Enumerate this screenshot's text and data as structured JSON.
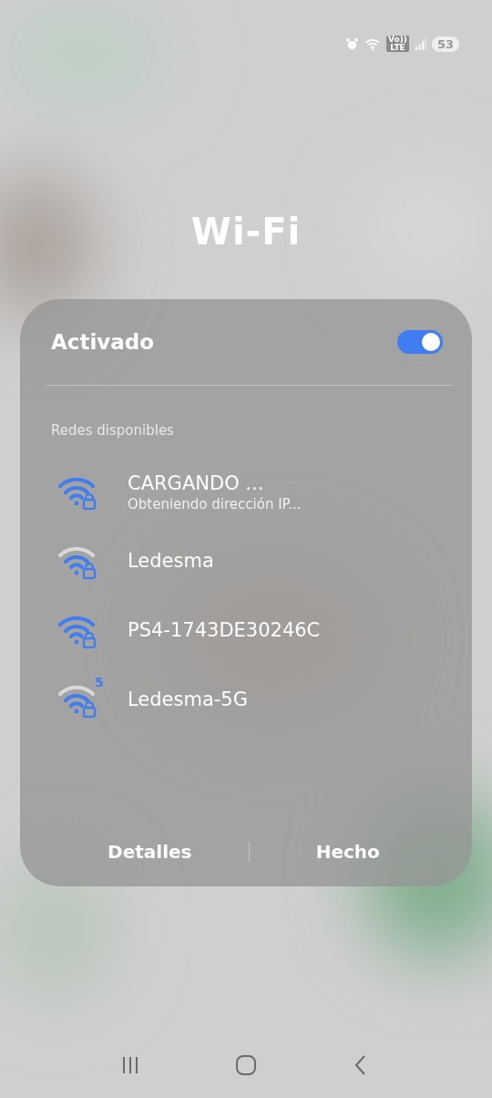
{
  "status_bar": {
    "network_label": "Vo))\nLTE",
    "battery": "53"
  },
  "title": "Wi-Fi",
  "wifi_switch": {
    "label": "Activado",
    "on": true
  },
  "section_label": "Redes disponibles",
  "networks": [
    {
      "name": "CARGANDO ...",
      "status": "Obteniendo dirección IP...",
      "full_signal": true
    },
    {
      "name": "Ledesma",
      "full_signal": false
    },
    {
      "name": "PS4-1743DE30246C",
      "full_signal": true
    },
    {
      "name": "Ledesma-5G",
      "full_signal": false,
      "band": "5"
    }
  ],
  "buttons": [
    "Detalles",
    "Hecho"
  ]
}
